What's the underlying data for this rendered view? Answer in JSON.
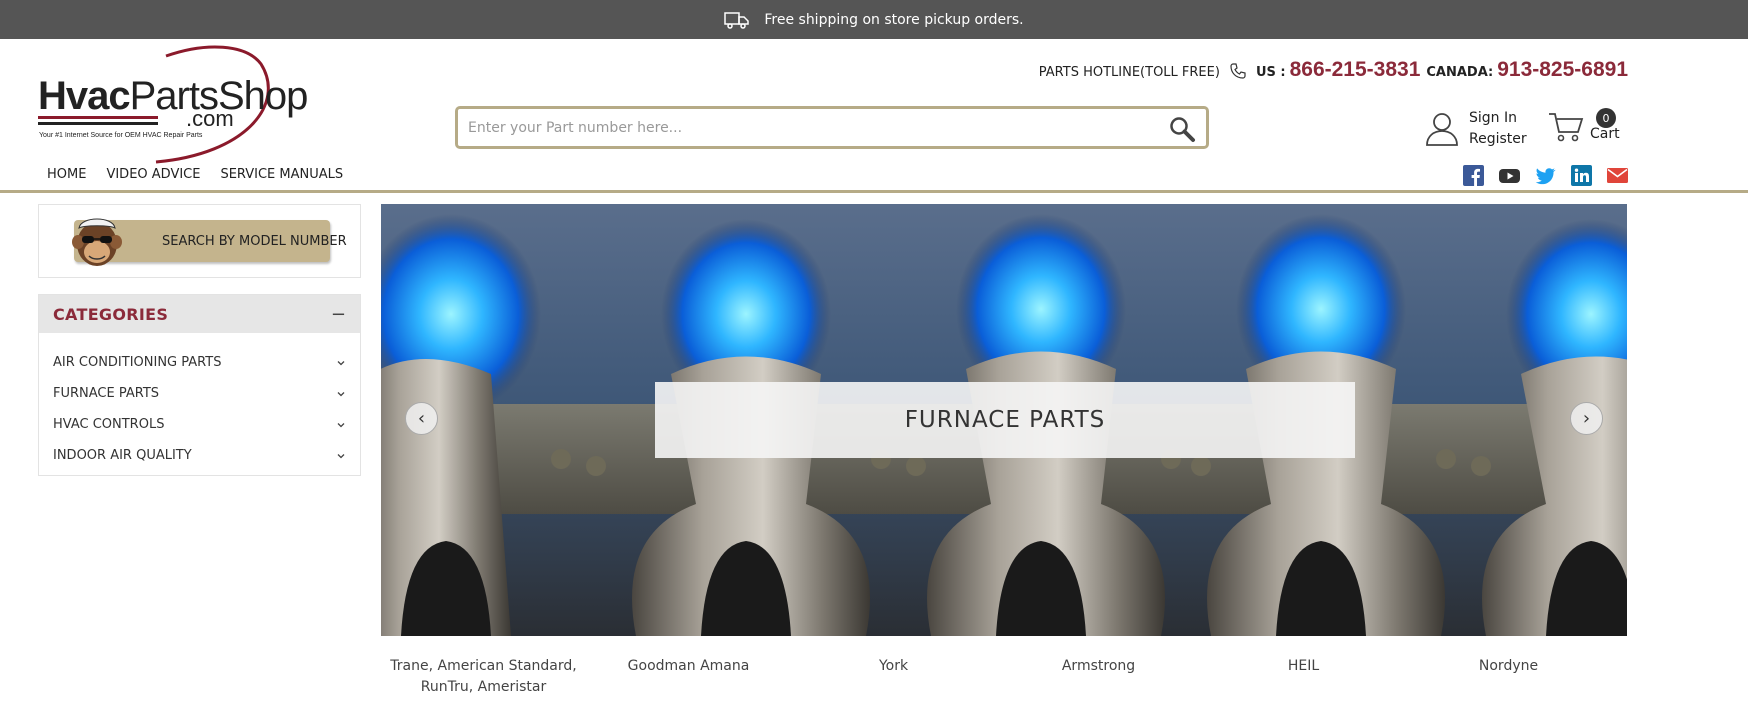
{
  "topbar": {
    "shipping_text": "Free shipping on store pickup orders.",
    "icon": "truck-icon"
  },
  "logo": {
    "word_bold": "Hvac",
    "word_rest": "PartsShop",
    "domain": ".com",
    "tagline": "Your #1 Internet Source for OEM HVAC Repair Parts"
  },
  "hotline": {
    "label": "PARTS HOTLINE(TOLL FREE)",
    "us_label": "US :",
    "us_number": "866-215-3831",
    "canada_label": "CANADA:",
    "canada_number": "913-825-6891"
  },
  "search": {
    "placeholder": "Enter your Part number here..."
  },
  "account": {
    "sign_in": "Sign In",
    "register": "Register"
  },
  "cart": {
    "count": "0",
    "label": "Cart"
  },
  "nav": {
    "items": [
      "HOME",
      "VIDEO ADVICE",
      "SERVICE MANUALS"
    ]
  },
  "social": [
    "facebook-icon",
    "youtube-icon",
    "twitter-icon",
    "linkedin-icon",
    "email-icon"
  ],
  "model_search": {
    "label": "SEARCH BY MODEL NUMBER"
  },
  "categories": {
    "title": "CATEGORIES",
    "toggle": "−",
    "items": [
      "AIR CONDITIONING PARTS",
      "FURNACE PARTS",
      "HVAC CONTROLS",
      "INDOOR AIR QUALITY"
    ]
  },
  "slider": {
    "caption": "FURNACE PARTS",
    "prev": "‹",
    "next": "›"
  },
  "brands": [
    "Trane, American Standard, RunTru, Ameristar",
    "Goodman Amana",
    "York",
    "Armstrong",
    "HEIL",
    "Nordyne"
  ],
  "colors": {
    "accent": "#8b2a3a",
    "gold": "#b6ab87",
    "topbar": "#555555"
  }
}
